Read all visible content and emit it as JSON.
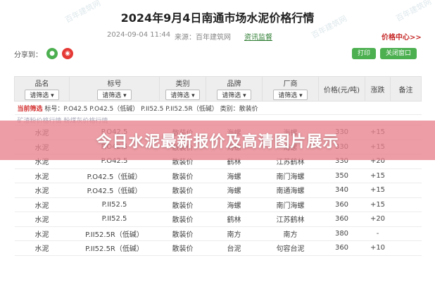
{
  "watermarks": [
    "百年建筑网",
    "百年建筑网",
    "百年建筑网"
  ],
  "title": "2024年9月4日南通市场水泥价格行情",
  "meta": {
    "date": "2024-09-04 11:44",
    "source": "来源：百年建筑网",
    "link": "资讯监督",
    "price_center": "价格中心>>"
  },
  "share": {
    "label": "分享到：",
    "wechat_icon": "wechat-icon",
    "weibo_icon": "weibo-icon"
  },
  "buttons": {
    "print": "打印",
    "close": "关闭窗口"
  },
  "table": {
    "headers": [
      {
        "label": "品名",
        "select": "请筛选"
      },
      {
        "label": "标号",
        "select": "请筛选"
      },
      {
        "label": "类别",
        "select": "请筛选"
      },
      {
        "label": "品牌",
        "select": "请筛选"
      },
      {
        "label": "厂商",
        "select": "请筛选"
      },
      {
        "label": "价格(元/吨)",
        "select": ""
      },
      {
        "label": "涨跌",
        "select": ""
      },
      {
        "label": "备注",
        "select": ""
      }
    ],
    "filter": {
      "label": "当前筛选",
      "grade": "标号：P.O42.5 P.O42.5（低碱） P.II52.5 P.II52.5R（低碱）",
      "category": "类别：散装价"
    },
    "ghost": "矿渣粉价格行情   粉煤灰价格行情",
    "rows": [
      [
        "水泥",
        "P.O42.5",
        "散装价",
        "海螺",
        "海螺",
        "330",
        "+15",
        ""
      ],
      [
        "水泥",
        "P.O42.5",
        "散装价",
        "海螺",
        "海螺",
        "330",
        "+15",
        ""
      ],
      [
        "水泥",
        "P.O42.5",
        "散装价",
        "鹤林",
        "江苏鹤林",
        "330",
        "+20",
        ""
      ],
      [
        "水泥",
        "P.O42.5（低碱）",
        "散装价",
        "海螺",
        "南门海螺",
        "350",
        "+15",
        ""
      ],
      [
        "水泥",
        "P.O42.5（低碱）",
        "散装价",
        "海螺",
        "南通海螺",
        "340",
        "+15",
        ""
      ],
      [
        "水泥",
        "P.II52.5",
        "散装价",
        "海螺",
        "南门海螺",
        "360",
        "+15",
        ""
      ],
      [
        "水泥",
        "P.II52.5",
        "散装价",
        "鹤林",
        "江苏鹤林",
        "360",
        "+20",
        ""
      ],
      [
        "水泥",
        "P.II52.5R（低碱）",
        "散装价",
        "南方",
        "南方",
        "380",
        "-",
        ""
      ],
      [
        "水泥",
        "P.II52.5R（低碱）",
        "散装价",
        "台泥",
        "句容台泥",
        "360",
        "+10",
        ""
      ]
    ]
  },
  "banner": "今日水泥最新报价及高清图片展示"
}
